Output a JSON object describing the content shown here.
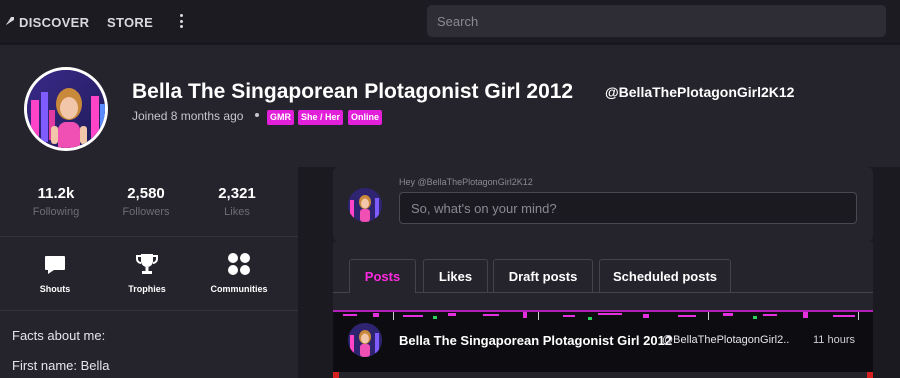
{
  "nav": {
    "discover_label": "DISCOVER",
    "store_label": "STORE",
    "search_placeholder": "Search"
  },
  "profile": {
    "display_name": "Bella The Singaporean Plotagonist Girl 2012",
    "handle": "@BellaThePlotagonGirl2K12",
    "joined": "Joined 8 months ago",
    "badges": [
      "GMR",
      "She / Her",
      "Online"
    ],
    "accent_color": "#e21fd9"
  },
  "stats": [
    {
      "value": "11.2k",
      "label": "Following"
    },
    {
      "value": "2,580",
      "label": "Followers"
    },
    {
      "value": "2,321",
      "label": "Likes"
    }
  ],
  "shortcuts": [
    {
      "label": "Shouts",
      "icon": "speech-bubble-icon"
    },
    {
      "label": "Trophies",
      "icon": "trophy-icon"
    },
    {
      "label": "Communities",
      "icon": "grid-circles-icon"
    }
  ],
  "facts": {
    "title": "Facts about me:",
    "first_name": "First name: Bella"
  },
  "compose": {
    "greeting": "Hey @BellaThePlotagonGirl2K12",
    "placeholder": "So, what's on your mind?"
  },
  "tabs": [
    {
      "label": "Posts",
      "active": true
    },
    {
      "label": "Likes",
      "active": false
    },
    {
      "label": "Draft posts",
      "active": false
    },
    {
      "label": "Scheduled posts",
      "active": false
    }
  ],
  "post": {
    "author_name": "Bella The Singaporean Plotagonist Girl 2012",
    "author_handle": "@BellaThePlotagonGirl2...",
    "time": "11 hours"
  }
}
